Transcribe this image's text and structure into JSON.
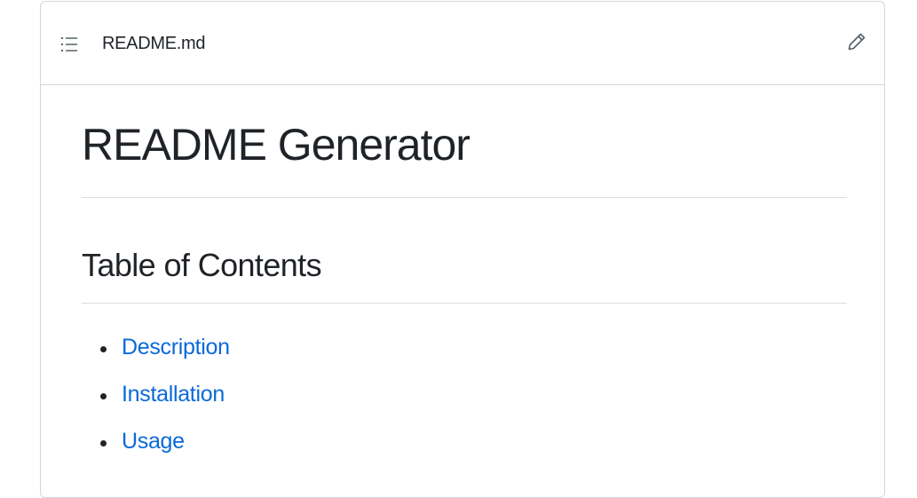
{
  "file": {
    "name": "README.md",
    "toc_icon": "list-unordered-icon",
    "edit_icon": "pencil-icon"
  },
  "content": {
    "title": "README Generator",
    "toc_heading": "Table of Contents",
    "toc_items": [
      {
        "label": "Description"
      },
      {
        "label": "Installation"
      },
      {
        "label": "Usage"
      }
    ]
  },
  "colors": {
    "link": "#0969da",
    "text": "#1f2328",
    "border": "#d0d7de"
  }
}
